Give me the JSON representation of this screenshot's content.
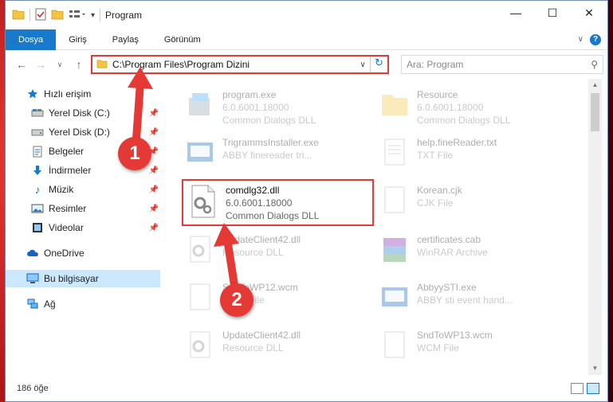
{
  "window": {
    "title": "Program"
  },
  "ribbon": {
    "tabs": [
      {
        "label": "Dosya",
        "active": true
      },
      {
        "label": "Giriş",
        "active": false
      },
      {
        "label": "Paylaş",
        "active": false
      },
      {
        "label": "Görünüm",
        "active": false
      }
    ],
    "help": "?"
  },
  "address_bar": {
    "path": "C:\\Program Files\\Program Dizini"
  },
  "search": {
    "placeholder": "Ara: Program"
  },
  "sidebar": {
    "items": [
      {
        "label": "Hızlı erişim",
        "icon": "star-icon",
        "pinned": false,
        "selected": false
      },
      {
        "label": "Yerel Disk (C:)",
        "icon": "drive-icon",
        "pinned": true,
        "selected": false
      },
      {
        "label": "Yerel Disk (D:)",
        "icon": "drive-icon",
        "pinned": true,
        "selected": false
      },
      {
        "label": "Belgeler",
        "icon": "documents-icon",
        "pinned": true,
        "selected": false
      },
      {
        "label": "İndirmeler",
        "icon": "download-icon",
        "pinned": true,
        "selected": false
      },
      {
        "label": "Müzik",
        "icon": "music-icon",
        "pinned": true,
        "selected": false
      },
      {
        "label": "Resimler",
        "icon": "pictures-icon",
        "pinned": true,
        "selected": false
      },
      {
        "label": "Videolar",
        "icon": "videos-icon",
        "pinned": true,
        "selected": false
      },
      {
        "label": "OneDrive",
        "icon": "cloud-icon",
        "pinned": false,
        "selected": false
      },
      {
        "label": "Bu bilgisayar",
        "icon": "computer-icon",
        "pinned": false,
        "selected": true
      },
      {
        "label": "Ağ",
        "icon": "network-icon",
        "pinned": false,
        "selected": false
      }
    ]
  },
  "files": [
    {
      "name": "program.exe",
      "line2": "6.0.6001.18000",
      "line3": "Common Dialogs DLL",
      "icon": "exe-icon",
      "dim": true
    },
    {
      "name": "Resource",
      "line2": "6.0.6001.18000",
      "line3": "Common Dialogs DLL",
      "icon": "folder-icon",
      "dim": true
    },
    {
      "name": "TrigrammsInstaller.exe",
      "line2": "ABBY finereader tri...",
      "line3": "",
      "icon": "installer-icon",
      "dim": true
    },
    {
      "name": "help.fineReader.txt",
      "line2": "TXT File",
      "line3": "",
      "icon": "txt-icon",
      "dim": true
    },
    {
      "name": "comdlg32.dll",
      "line2": "6.0.6001.18000",
      "line3": "Common Dialogs DLL",
      "icon": "dll-icon",
      "dim": false
    },
    {
      "name": "Korean.cjk",
      "line2": "CJK File",
      "line3": "",
      "icon": "file-icon",
      "dim": true
    },
    {
      "name": "UpdateClient42.dll",
      "line2": "Resource DLL",
      "line3": "",
      "icon": "dll-icon",
      "dim": true
    },
    {
      "name": "certificates.cab",
      "line2": "WinRAR Archive",
      "line3": "",
      "icon": "archive-icon",
      "dim": true
    },
    {
      "name": "SndToWP12.wcm",
      "line2": "WCM File",
      "line3": "",
      "icon": "file-icon",
      "dim": true
    },
    {
      "name": "AbbyySTI.exe",
      "line2": "ABBY sti event hand...",
      "line3": "",
      "icon": "exe-icon",
      "dim": true
    },
    {
      "name": "UpdateClient42.dll",
      "line2": "Resource DLL",
      "line3": "",
      "icon": "dll-icon",
      "dim": true
    },
    {
      "name": "SndToWP13.wcm",
      "line2": "WCM File",
      "line3": "",
      "icon": "file-icon",
      "dim": true
    }
  ],
  "status_bar": {
    "item_count": "186 öğe"
  },
  "annotations": {
    "callout_1": "1",
    "callout_2": "2",
    "color": "#e53935"
  },
  "colors": {
    "accent": "#1979ca",
    "selection": "#cce8ff",
    "highlight": "#e53935"
  }
}
